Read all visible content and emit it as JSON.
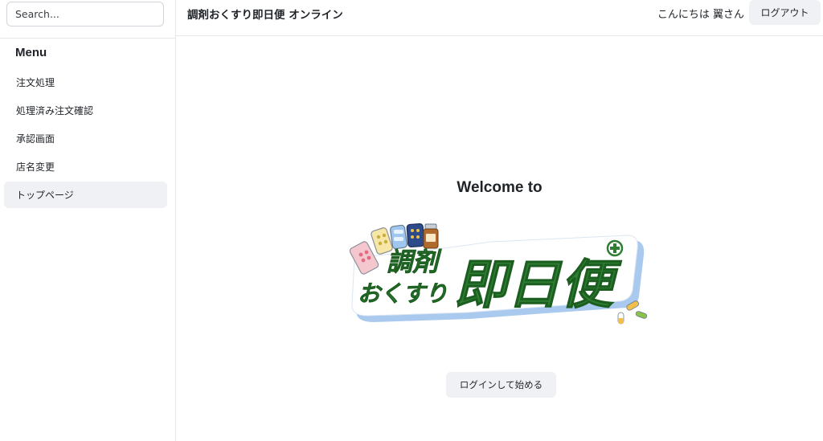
{
  "search": {
    "placeholder": "Search..."
  },
  "sidebar": {
    "title": "Menu",
    "items": [
      {
        "label": "注文処理",
        "active": false
      },
      {
        "label": "処理済み注文確認",
        "active": false
      },
      {
        "label": "承認画面",
        "active": false
      },
      {
        "label": "店名変更",
        "active": false
      },
      {
        "label": "トップページ",
        "active": true
      }
    ]
  },
  "header": {
    "app_title": "調剤おくすり即日便 オンライン",
    "greeting": "こんにちは 翼さん",
    "logout_label": "ログアウト"
  },
  "main": {
    "welcome": "Welcome to",
    "logo": {
      "line1": "調剤",
      "line2": "おくすり",
      "line3": "即日便",
      "brand_green": "#2e7d32",
      "shadow_blue": "#a9c9ef"
    },
    "start_label": "ログインして始める"
  },
  "colors": {
    "border": "#e5e7eb",
    "button_bg": "#f0f1f4",
    "text": "#1f2328"
  }
}
